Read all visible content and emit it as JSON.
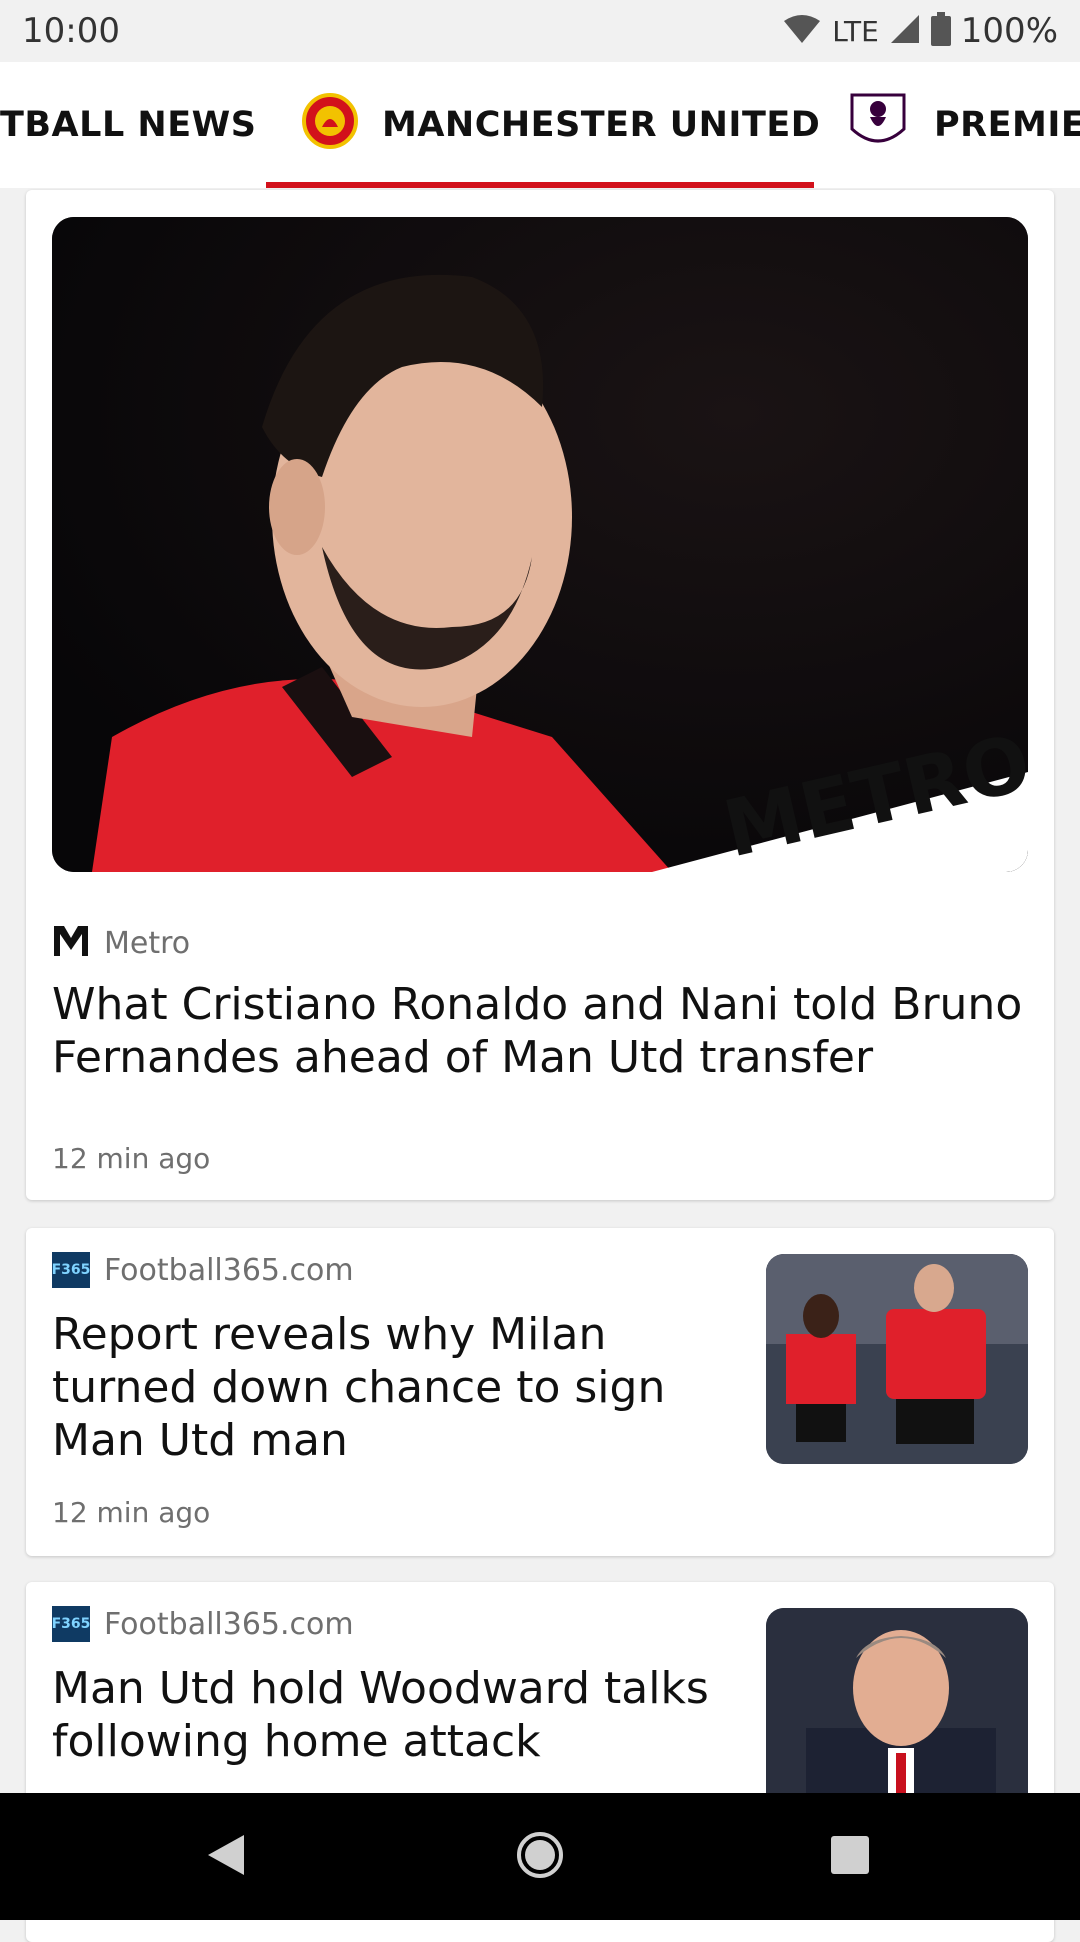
{
  "status_bar": {
    "time": "10:00",
    "network": "LTE",
    "battery": "100%"
  },
  "tabs": [
    {
      "label": "TBALL NEWS"
    },
    {
      "label": "MANCHESTER UNITED",
      "selected": true
    },
    {
      "label": "PREMIER"
    }
  ],
  "articles": [
    {
      "source": "Metro",
      "title": "What Cristiano Ronaldo and Nani told Bruno Fernandes ahead of Man Utd transfer",
      "time": "12 min ago",
      "image_watermark": "METRO.c"
    },
    {
      "source": "Football365.com",
      "title": "Report reveals why Milan turned down chance to sign Man Utd man",
      "time": "12 min ago"
    },
    {
      "source": "Football365.com",
      "title": "Man Utd hold Woodward talks following home attack"
    }
  ],
  "source_logo_text": "F365",
  "colors": {
    "accent": "#d2111b",
    "kit_red": "#e0202b"
  },
  "icons": [
    "wifi-icon",
    "signal-icon",
    "battery-icon",
    "back-icon",
    "home-icon",
    "recents-icon"
  ]
}
